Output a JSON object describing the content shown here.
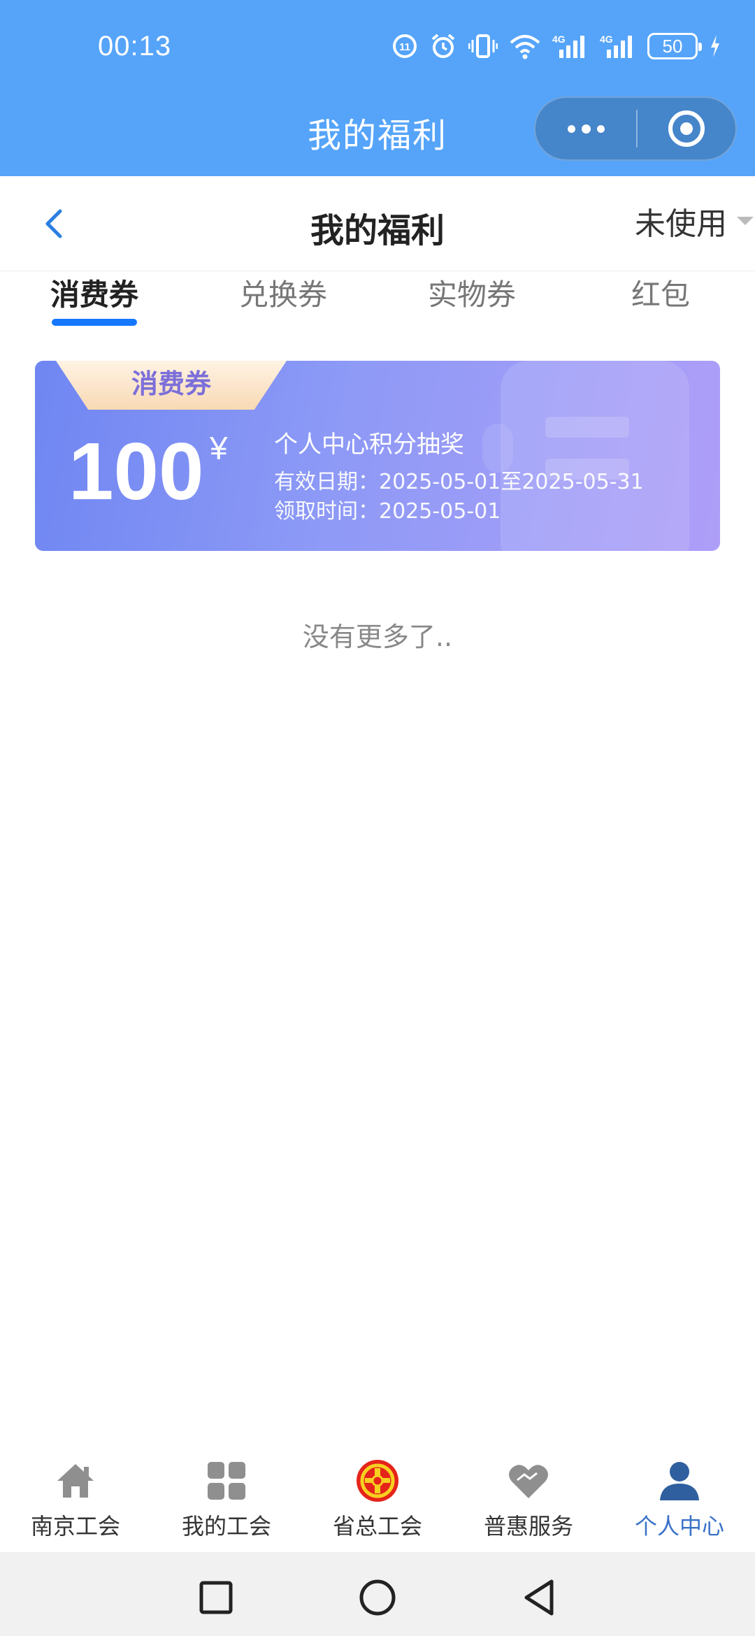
{
  "status_bar": {
    "time": "00:13",
    "battery": "50"
  },
  "mini_program": {
    "title": "我的福利"
  },
  "header": {
    "title": "我的福利",
    "filter_label": "未使用"
  },
  "tabs": [
    {
      "label": "消费券",
      "active": true
    },
    {
      "label": "兑换券",
      "active": false
    },
    {
      "label": "实物券",
      "active": false
    },
    {
      "label": "红包",
      "active": false
    }
  ],
  "coupon": {
    "tag": "消费券",
    "amount": "100",
    "currency": "¥",
    "name": "个人中心积分抽奖",
    "validity": "有效日期：2025-05-01至2025-05-31",
    "received": "领取时间：2025-05-01"
  },
  "list_end_text": "没有更多了..",
  "tabbar": [
    {
      "label": "南京工会",
      "icon": "home-icon"
    },
    {
      "label": "我的工会",
      "icon": "grid-icon"
    },
    {
      "label": "省总工会",
      "icon": "union-emblem-icon"
    },
    {
      "label": "普惠服务",
      "icon": "heart-icon"
    },
    {
      "label": "个人中心",
      "icon": "user-icon",
      "active": true
    }
  ],
  "colors": {
    "header_blue": "#55a4fa",
    "tab_indicator": "#1677ff",
    "active_tab_text": "#3a72c8",
    "coupon_gradient_start": "#6f86f2",
    "coupon_gradient_end": "#ae9ef8"
  }
}
